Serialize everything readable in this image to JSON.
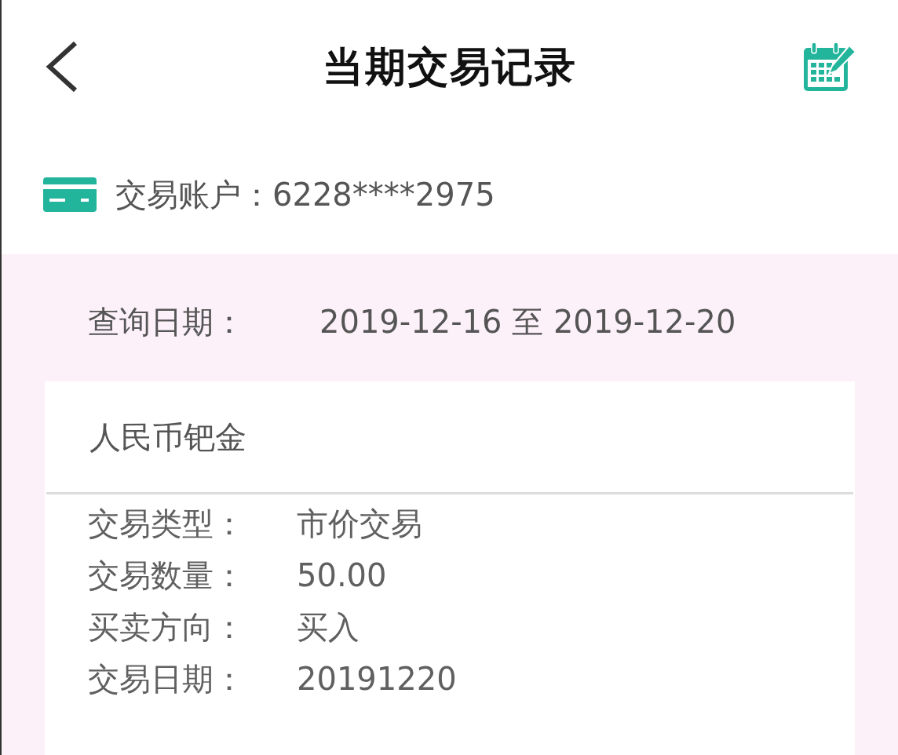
{
  "header": {
    "title": "当期交易记录"
  },
  "account": {
    "label": "交易账户：",
    "value": "6228****2975"
  },
  "query": {
    "label": "查询日期：",
    "value": "2019-12-16 至 2019-12-20"
  },
  "card": {
    "title": "人民币钯金",
    "fields": [
      {
        "label": "交易类型：",
        "value": "市价交易"
      },
      {
        "label": "交易数量：",
        "value": "50.00"
      },
      {
        "label": "买卖方向：",
        "value": "买入"
      },
      {
        "label": "交易日期：",
        "value": "20191220"
      }
    ]
  }
}
